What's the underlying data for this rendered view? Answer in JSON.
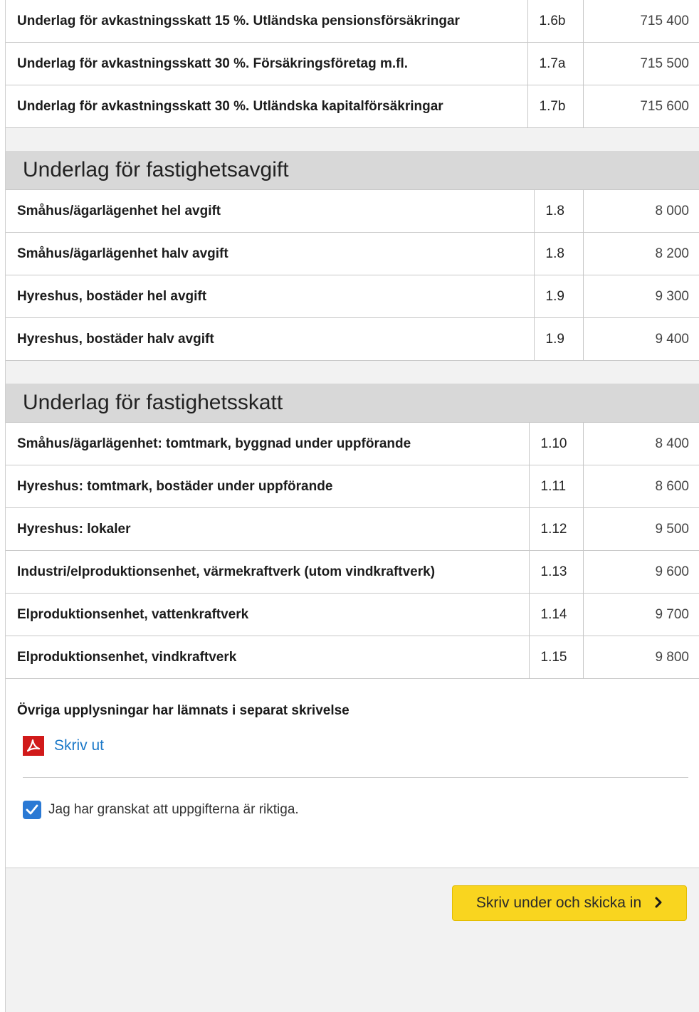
{
  "group1": {
    "rows": [
      {
        "label": "Underlag för avkastningsskatt 15 %. Utländska pensionsförsäkringar",
        "code": "1.6b",
        "amount": "715 400"
      },
      {
        "label": "Underlag för avkastningsskatt 30 %. Försäkringsföretag m.fl.",
        "code": "1.7a",
        "amount": "715 500"
      },
      {
        "label": "Underlag för avkastningsskatt 30 %. Utländska kapitalförsäkringar",
        "code": "1.7b",
        "amount": "715 600"
      }
    ]
  },
  "fastighetsavgift": {
    "heading": "Underlag för fastighetsavgift",
    "rows": [
      {
        "label": "Småhus/ägarlägenhet hel avgift",
        "code": "1.8",
        "amount": "8 000"
      },
      {
        "label": "Småhus/ägarlägenhet halv avgift",
        "code": "1.8",
        "amount": "8 200"
      },
      {
        "label": "Hyreshus, bostäder hel avgift",
        "code": "1.9",
        "amount": "9 300"
      },
      {
        "label": "Hyreshus, bostäder halv avgift",
        "code": "1.9",
        "amount": "9 400"
      }
    ]
  },
  "fastighetsskatt": {
    "heading": "Underlag för fastighetsskatt",
    "rows": [
      {
        "label": "Småhus/ägarlägenhet: tomtmark, byggnad under uppförande",
        "code": "1.10",
        "amount": "8 400"
      },
      {
        "label": "Hyreshus: tomtmark, bostäder under uppförande",
        "code": "1.11",
        "amount": "8 600"
      },
      {
        "label": "Hyreshus: lokaler",
        "code": "1.12",
        "amount": "9 500"
      },
      {
        "label": "Industri/elproduktionsenhet, värmekraftverk (utom vindkraftverk)",
        "code": "1.13",
        "amount": "9 600"
      },
      {
        "label": "Elproduktionsenhet, vattenkraftverk",
        "code": "1.14",
        "amount": "9 700"
      },
      {
        "label": "Elproduktionsenhet, vindkraftverk",
        "code": "1.15",
        "amount": "9 800"
      }
    ]
  },
  "footer": {
    "note": "Övriga upplysningar har lämnats i separat skrivelse",
    "print_label": "Skriv ut",
    "confirm_label": "Jag har granskat att uppgifterna är riktiga.",
    "confirm_checked": true,
    "submit_label": "Skriv under och skicka in"
  },
  "colors": {
    "submit_button": "#f9d51f",
    "link": "#1a78c8",
    "checkbox": "#2a79d4",
    "pdf_icon": "#d11a1a"
  },
  "icons": {
    "pdf": "pdf-icon",
    "checkbox": "checkmark-icon",
    "submit": "chevron-right-icon"
  }
}
